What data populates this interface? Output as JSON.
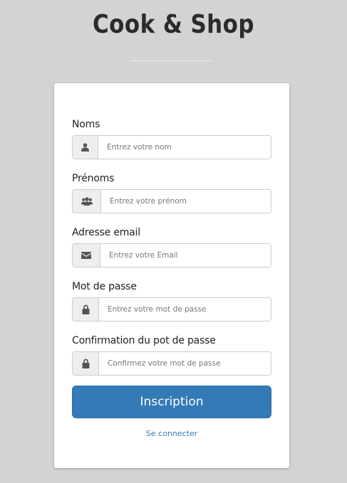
{
  "header": {
    "title": "Cook & Shop"
  },
  "form": {
    "fields": [
      {
        "label": "Noms",
        "placeholder": "Entrez votre nom",
        "icon": "user-icon"
      },
      {
        "label": "Prénoms",
        "placeholder": "Entrez votre prénom",
        "icon": "users-icon"
      },
      {
        "label": "Adresse email",
        "placeholder": "Entrez votre Email",
        "icon": "envelope-icon"
      },
      {
        "label": "Mot de passe",
        "placeholder": "Entrez votre mot de passe",
        "icon": "lock-icon"
      },
      {
        "label": "Confirmation du pot de passe",
        "placeholder": "Confirmez votre mot de passe",
        "icon": "lock-icon"
      }
    ],
    "submit_label": "Inscription",
    "login_link": "Se connecter"
  },
  "colors": {
    "background": "#d3d3d3",
    "card": "#ffffff",
    "primary": "#337ab7",
    "addon": "#eeeeee"
  }
}
